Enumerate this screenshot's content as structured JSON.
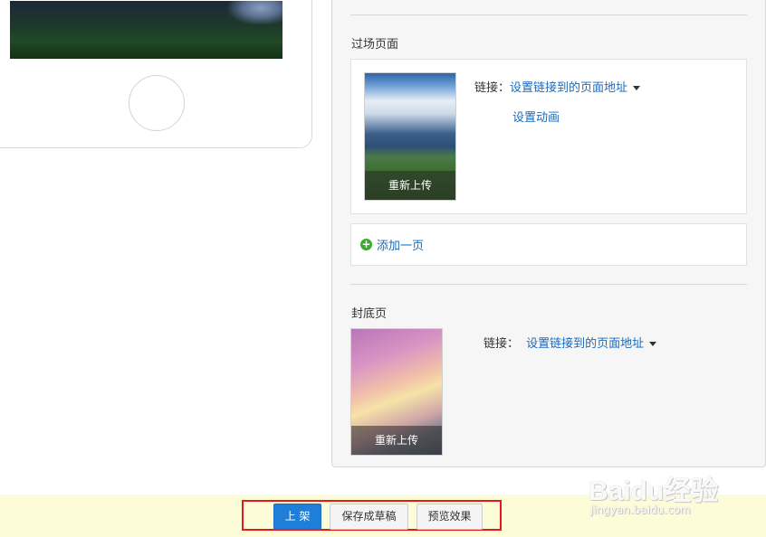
{
  "transition_section": {
    "title": "过场页面",
    "reupload_label": "重新上传",
    "link_label": "链接：",
    "link_value": "设置链接到的页面地址",
    "animation_link": "设置动画"
  },
  "add_page": {
    "label": "添加一页"
  },
  "back_cover_section": {
    "title": "封底页",
    "reupload_label": "重新上传",
    "link_label": "链接：",
    "link_value": "设置链接到的页面地址"
  },
  "actions": {
    "publish": "上 架",
    "save_draft": "保存成草稿",
    "preview": "预览效果"
  },
  "watermark": {
    "brand": "Baidu经验",
    "url": "jingyan.baidu.com"
  },
  "colors": {
    "link_blue": "#1a6bbd",
    "primary_button": "#1f7fd8",
    "action_bar_bg": "#fdfcd9",
    "highlight_border": "#e3191c",
    "add_icon_green": "#3bab2f"
  }
}
